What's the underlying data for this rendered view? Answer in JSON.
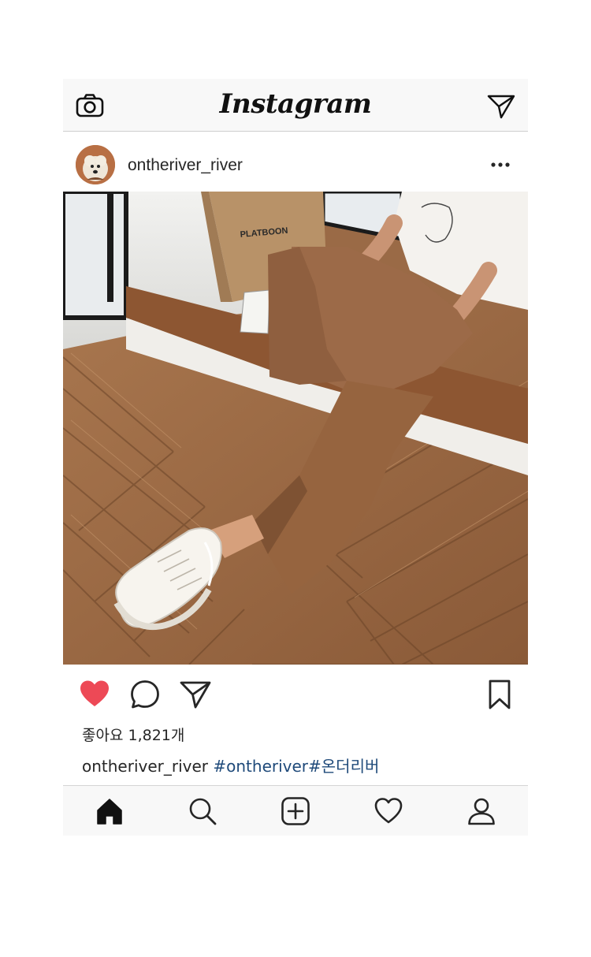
{
  "app": {
    "logo_text": "Instagram"
  },
  "post": {
    "username": "ontheriver_river",
    "image_text": "PLATBOON",
    "likes_text": "좋아요 1,821개",
    "caption_user": "ontheriver_river",
    "caption_tags": "#ontheriver#온더리버",
    "liked": true
  },
  "icons": {
    "top_left": "camera-icon",
    "top_right": "direct-message-icon",
    "more": "more-options-icon",
    "like": "heart-icon",
    "comment": "comment-icon",
    "share": "share-icon",
    "save": "bookmark-icon",
    "nav": [
      "home-icon",
      "search-icon",
      "add-post-icon",
      "activity-heart-icon",
      "profile-icon"
    ]
  },
  "colors": {
    "like_red": "#ed4956",
    "hashtag_blue": "#1f4a7a",
    "bar_bg": "#f8f8f8"
  }
}
